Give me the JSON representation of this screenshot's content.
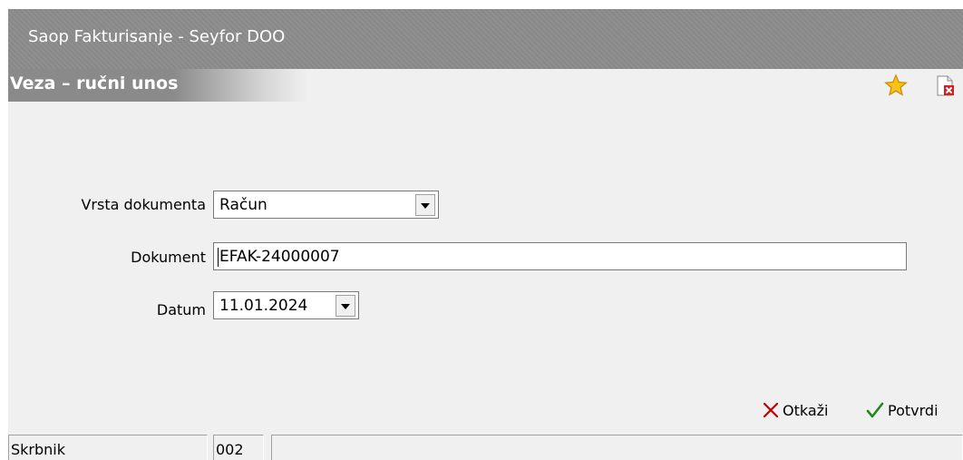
{
  "window": {
    "title": "Saop Fakturisanje - Seyfor DOO"
  },
  "header": {
    "title": "Veza – ručni unos",
    "icons": {
      "favorite": "star-icon",
      "close": "close-document-icon"
    }
  },
  "form": {
    "vrsta_dokumenta": {
      "label": "Vrsta dokumenta",
      "value": "Račun"
    },
    "dokument": {
      "label": "Dokument",
      "value": "EFAK-24000007"
    },
    "datum": {
      "label": "Datum",
      "value": "11.01.2024"
    }
  },
  "actions": {
    "cancel": {
      "label": "Otkaži",
      "icon": "x-icon"
    },
    "confirm": {
      "label": "Potvrdi",
      "icon": "checkmark-icon"
    }
  },
  "statusbar": {
    "label": "Skrbnik",
    "value": "002",
    "extra": ""
  },
  "colors": {
    "confirm_check": "#1e8a1e",
    "cancel_x": "#c00000",
    "star": "#f5b400"
  }
}
